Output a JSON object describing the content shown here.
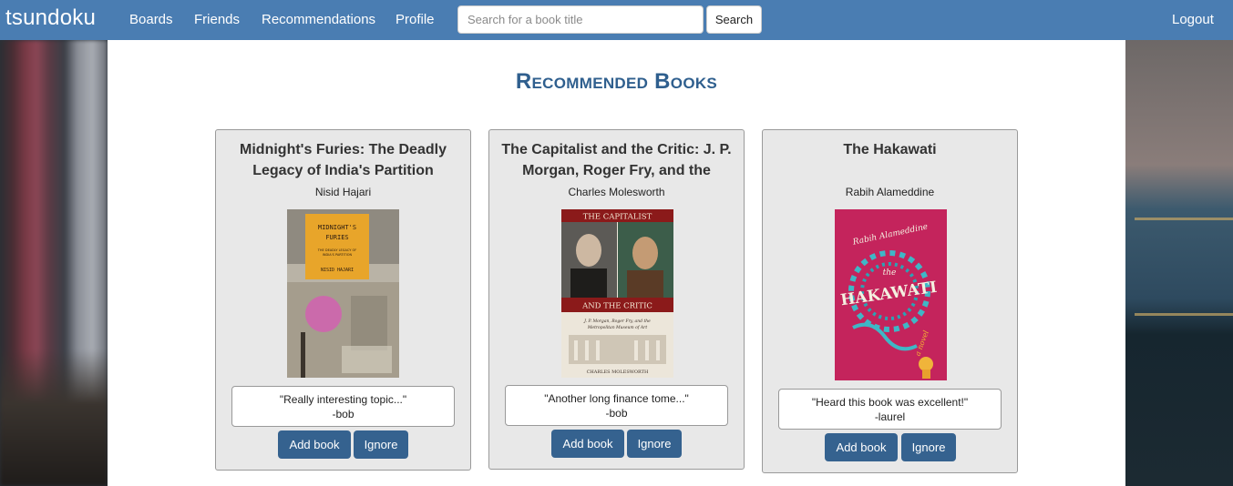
{
  "navbar": {
    "brand": "tsundoku",
    "links": [
      "Boards",
      "Friends",
      "Recommendations",
      "Profile"
    ],
    "search": {
      "placeholder": "Search for a book title",
      "value": ""
    },
    "search_button": "Search",
    "logout": "Logout"
  },
  "page_title": "Recommended Books",
  "books": [
    {
      "title": "Midnight's Furies: The Deadly Legacy of India's Partition",
      "author": "Nisid Hajari",
      "quote": "\"Really interesting topic...\"",
      "recommender": "-bob",
      "cover": {
        "title_text": "MIDNIGHT'S FURIES",
        "subtitle": "THE DEADLY LEGACY OF INDIA'S PARTITION",
        "author_text": "NISID HAJARI",
        "accent": "#e8a52a"
      },
      "add_label": "Add book",
      "ignore_label": "Ignore"
    },
    {
      "title": "The Capitalist and the Critic: J. P. Morgan, Roger Fry, and the Metropolitan Museum of Art",
      "author": "Charles Molesworth",
      "quote": "\"Another long finance tome...\"",
      "recommender": "-bob",
      "cover": {
        "title_text": "THE CAPITALIST",
        "title_text_2": "AND THE CRITIC",
        "subtitle": "J. P. Morgan, Roger Fry, and the Metropolitan Museum of Art",
        "author_text": "CHARLES MOLESWORTH",
        "accent": "#8b1a1a"
      },
      "add_label": "Add book",
      "ignore_label": "Ignore"
    },
    {
      "title": "The Hakawati",
      "author": "Rabih Alameddine",
      "quote": "\"Heard this book was excellent!\"",
      "recommender": "-laurel",
      "cover": {
        "author_text": "Rabih Alameddine",
        "title_text": "the HAKAWATI",
        "subtitle": "a novel",
        "accent": "#c4245c"
      },
      "add_label": "Add book",
      "ignore_label": "Ignore"
    }
  ],
  "colors": {
    "navbar": "#4a7db2",
    "button": "#35628f",
    "title": "#2f5f8e",
    "card": "#e8e8e8"
  }
}
